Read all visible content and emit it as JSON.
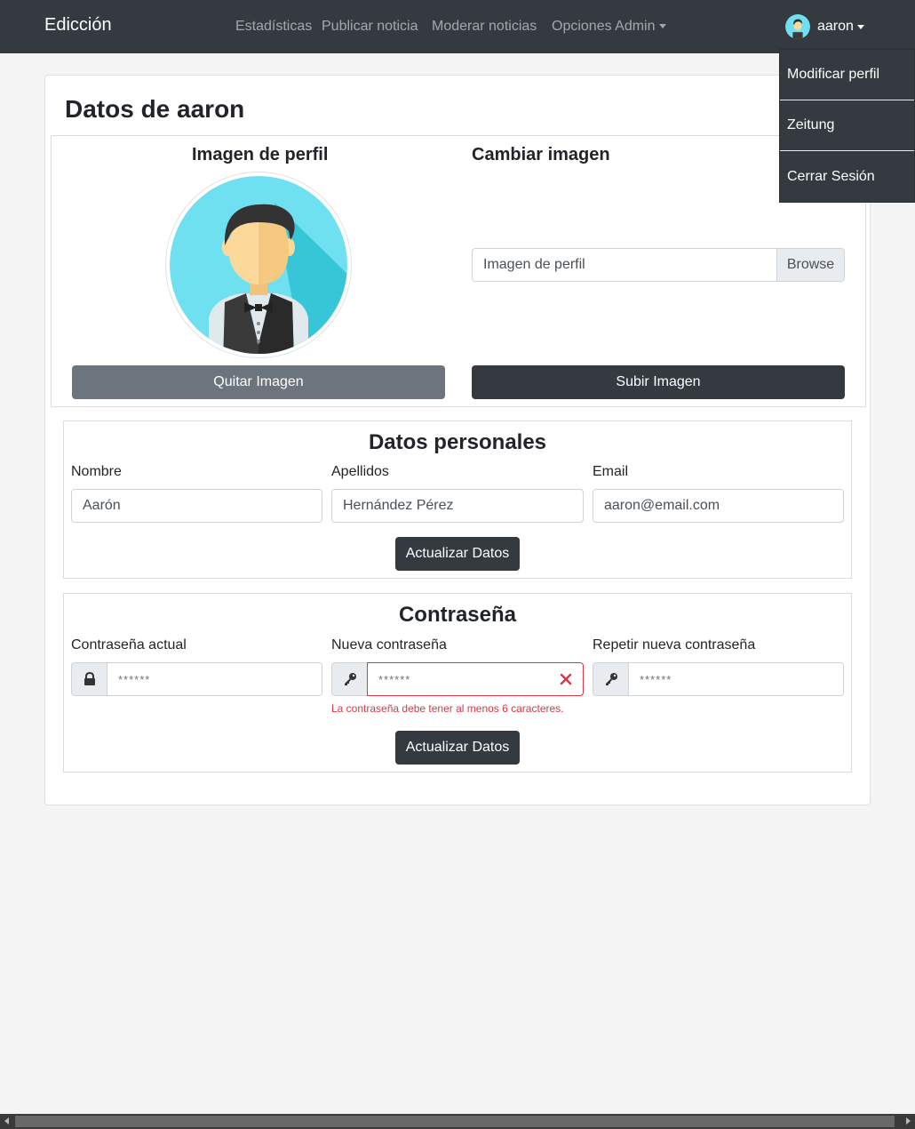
{
  "navbar": {
    "brand": "Edicción",
    "links": [
      "Estadísticas",
      "Publicar noticia",
      "Moderar noticias"
    ],
    "admin_label": "Opciones Admin",
    "user_name": "aaron"
  },
  "dropdown": {
    "items": [
      "Modificar perfil",
      "Zeitung",
      "Cerrar Sesión"
    ]
  },
  "page": {
    "title": "Datos de aaron"
  },
  "image_section": {
    "profile_title": "Imagen de perfil",
    "change_title": "Cambiar imagen",
    "file_placeholder": "Imagen de perfil",
    "browse_label": "Browse",
    "remove_button": "Quitar Imagen",
    "upload_button": "Subir Imagen"
  },
  "personal": {
    "title": "Datos personales",
    "name_label": "Nombre",
    "name_value": "Aarón",
    "surname_label": "Apellidos",
    "surname_value": "Hernández Pérez",
    "email_label": "Email",
    "email_value": "aaron@email.com",
    "submit": "Actualizar Datos"
  },
  "password": {
    "title": "Contraseña",
    "current_label": "Contraseña actual",
    "current_value": "******",
    "new_label": "Nueva contraseña",
    "new_value": "******",
    "new_error": "La contraseña debe tener al menos 6 caracteres.",
    "repeat_label": "Repetir nueva contraseña",
    "repeat_value": "******",
    "submit": "Actualizar Datos"
  },
  "icons": {
    "lock": "lock-icon",
    "key": "key-icon",
    "error": "x-icon",
    "avatar": "waiter-avatar"
  },
  "colors": {
    "navbar": "#343a40",
    "secondary": "#6c757d",
    "danger": "#dc3545",
    "avatar_bg": "#6fe0ef"
  }
}
